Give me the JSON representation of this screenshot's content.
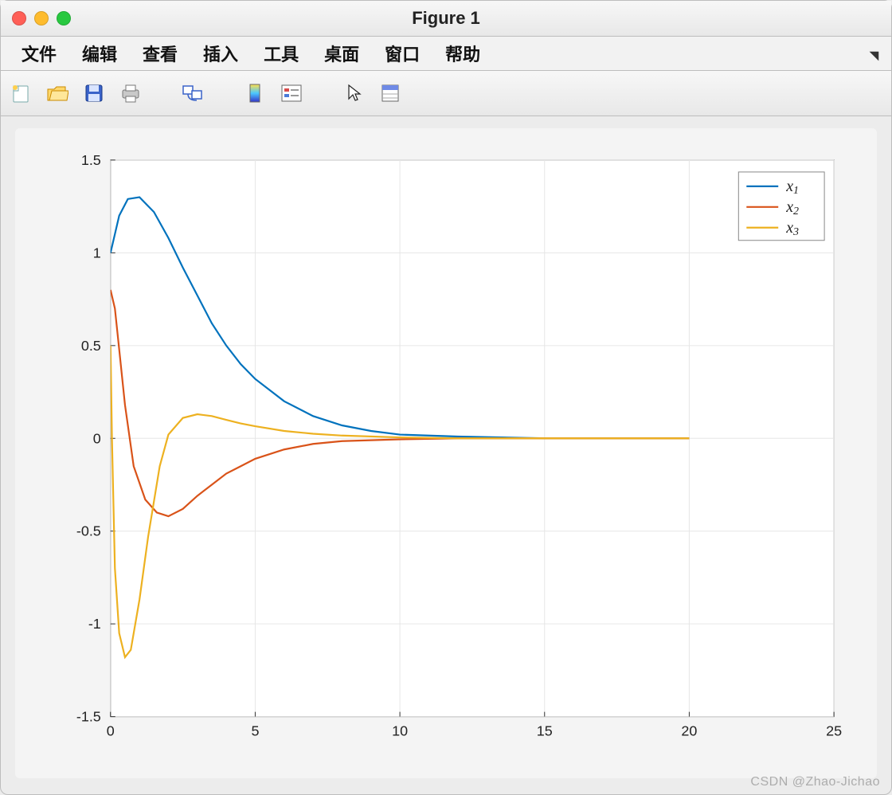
{
  "window": {
    "title": "Figure 1"
  },
  "menu": [
    "文件",
    "编辑",
    "查看",
    "插入",
    "工具",
    "桌面",
    "窗口",
    "帮助"
  ],
  "watermark": "CSDN @Zhao-Jichao",
  "chart_data": {
    "type": "line",
    "xlim": [
      0,
      25
    ],
    "ylim": [
      -1.5,
      1.5
    ],
    "xticks": [
      0,
      5,
      10,
      15,
      20,
      25
    ],
    "yticks": [
      -1.5,
      -1,
      -0.5,
      0,
      0.5,
      1,
      1.5
    ],
    "xlabel": "",
    "ylabel": "",
    "grid": true,
    "legend_position": "northeast",
    "colors": [
      "#0072BD",
      "#D95319",
      "#EDB120"
    ],
    "series": [
      {
        "name": "x",
        "sub": "1",
        "x": [
          0,
          0.3,
          0.6,
          1.0,
          1.5,
          2.0,
          2.5,
          3.0,
          3.5,
          4.0,
          4.5,
          5.0,
          6.0,
          7.0,
          8.0,
          9.0,
          10.0,
          12.0,
          15.0,
          20.0
        ],
        "y": [
          1.0,
          1.2,
          1.29,
          1.3,
          1.22,
          1.08,
          0.92,
          0.77,
          0.62,
          0.5,
          0.4,
          0.32,
          0.2,
          0.12,
          0.07,
          0.04,
          0.02,
          0.01,
          0.0,
          0.0
        ]
      },
      {
        "name": "x",
        "sub": "2",
        "x": [
          0,
          0.15,
          0.3,
          0.5,
          0.8,
          1.2,
          1.6,
          2.0,
          2.5,
          3.0,
          3.5,
          4.0,
          4.5,
          5.0,
          6.0,
          7.0,
          8.0,
          10.0,
          12.0,
          15.0,
          20.0
        ],
        "y": [
          0.8,
          0.7,
          0.48,
          0.18,
          -0.15,
          -0.33,
          -0.4,
          -0.42,
          -0.38,
          -0.31,
          -0.25,
          -0.19,
          -0.15,
          -0.11,
          -0.06,
          -0.03,
          -0.015,
          -0.005,
          0.0,
          0.0,
          0.0
        ]
      },
      {
        "name": "x",
        "sub": "3",
        "x": [
          0,
          0.05,
          0.15,
          0.3,
          0.5,
          0.7,
          1.0,
          1.3,
          1.7,
          2.0,
          2.5,
          3.0,
          3.5,
          4.0,
          4.5,
          5.0,
          6.0,
          7.0,
          8.0,
          10.0,
          12.0,
          15.0,
          20.0
        ],
        "y": [
          0.5,
          0.0,
          -0.7,
          -1.05,
          -1.18,
          -1.14,
          -0.87,
          -0.53,
          -0.15,
          0.02,
          0.11,
          0.13,
          0.12,
          0.1,
          0.08,
          0.065,
          0.04,
          0.025,
          0.015,
          0.005,
          0.0,
          0.0,
          0.0
        ]
      }
    ]
  }
}
